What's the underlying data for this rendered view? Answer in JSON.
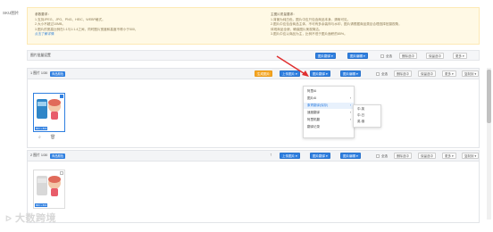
{
  "sku_label": "SKU图片",
  "tips": {
    "left_title": "参数要求：",
    "left_lines": [
      "1.支持JPEG、JPG、PNG、HEIC、WEBP格式。",
      "2.大小不超过10MB。",
      "3.图片的宽高比例在1:1与1:1.4之间，同时图片宽度和高度不得小于500，"
    ],
    "left_link": "点击了解详情",
    "right_title": "主图片质量要求：",
    "right_lines": [
      "1.背景为纯白色，图片中应只包含商品本身，清晰可见。",
      "2.图片中应包含商品主体，不可有多余装饰与水印，图片请根据商品类目合理选择拍摄视角，",
      "体现商品全貌，确保图片美观简洁。",
      "3.图片中应以商品为主，比例不低于图片面积的85%。"
    ]
  },
  "toolbar": {
    "title": "图片批量设置",
    "btn_translate": "图片翻译",
    "btn_edit": "图片编辑",
    "check_all": "全选",
    "btn_delete": "删除选中",
    "btn_save": "保留选中",
    "btn_more": "更多"
  },
  "panel1": {
    "title": "1 图片 1/30",
    "badge": "商品颜色",
    "btn_generate": "生成图片",
    "btn_upload": "上传图片",
    "btn_translate": "图片翻译",
    "btn_edit": "图片编辑",
    "check_all": "全选",
    "btn_delete": "删除选中",
    "btn_save": "保留选中",
    "btn_more": "更多",
    "btn_copy": "复制到",
    "thumb_caption": "800 x 800"
  },
  "panel2": {
    "title": "2 图片 1/30",
    "badge": "商品颜色",
    "btn_upload": "上传图片",
    "btn_translate": "图片翻译",
    "btn_edit": "图片编辑",
    "check_all": "全选",
    "btn_delete": "删除选中",
    "btn_save": "保留选中",
    "btn_more": "更多",
    "btn_copy": "复制到",
    "thumb_caption": "800 x 800"
  },
  "dropdown": {
    "items": [
      "阿里AI",
      "图片AI",
      "象寄翻译(保存)",
      "速度翻译",
      "阿里机翻",
      "翻译记录"
    ],
    "active_index": 2,
    "submenu": [
      "中-英",
      "中-日",
      "英-俄"
    ]
  },
  "watermark": "大数跨境",
  "colors": {
    "primary": "#2f7fe0",
    "orange": "#f5a623",
    "tips_bg": "#fff9e5",
    "arrow": "#e03030"
  }
}
